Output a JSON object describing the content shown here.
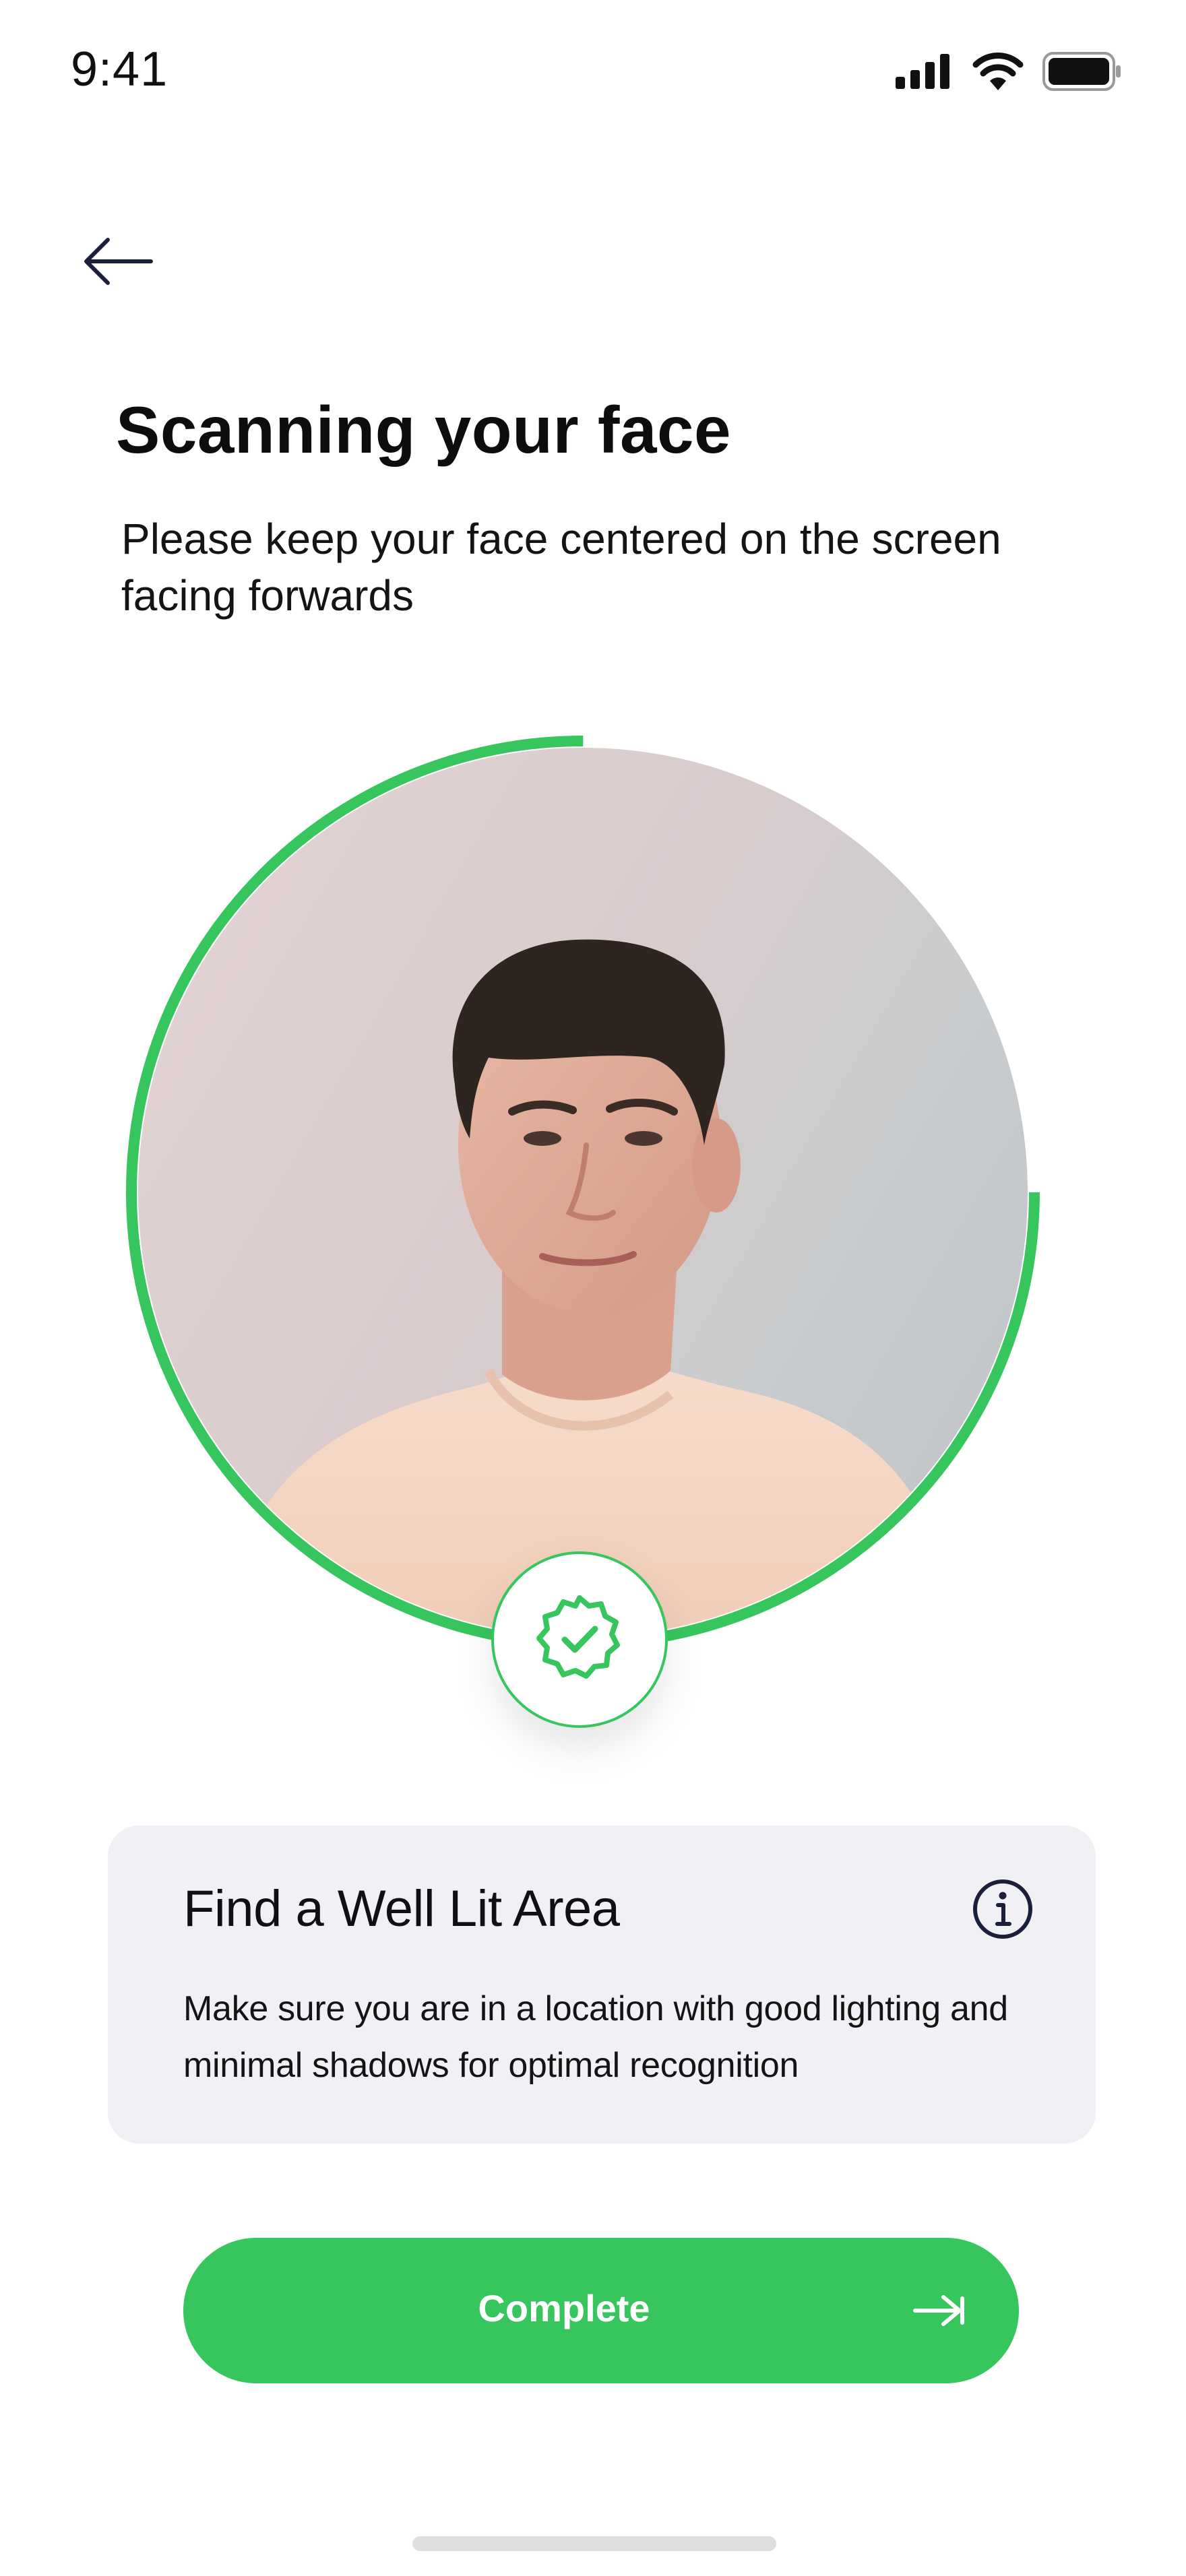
{
  "status_bar": {
    "time": "9:41",
    "icons": [
      "signal-icon",
      "wifi-icon",
      "battery-icon"
    ]
  },
  "nav": {
    "back_icon": "arrow-left-icon"
  },
  "header": {
    "title": "Scanning your face",
    "subtitle": "Please keep your face centered on the screen facing forwards"
  },
  "scanner": {
    "progress": 0.75,
    "progress_color": "#36c65d",
    "badge_icon": "verified-badge-icon"
  },
  "info_card": {
    "title": "Find a Well Lit Area",
    "description": "Make sure you are in a location with good lighting and minimal shadows for optimal recognition",
    "icon": "info-icon"
  },
  "primary_action": {
    "label": "Complete",
    "icon": "arrow-right-icon",
    "color": "#36c65d"
  }
}
